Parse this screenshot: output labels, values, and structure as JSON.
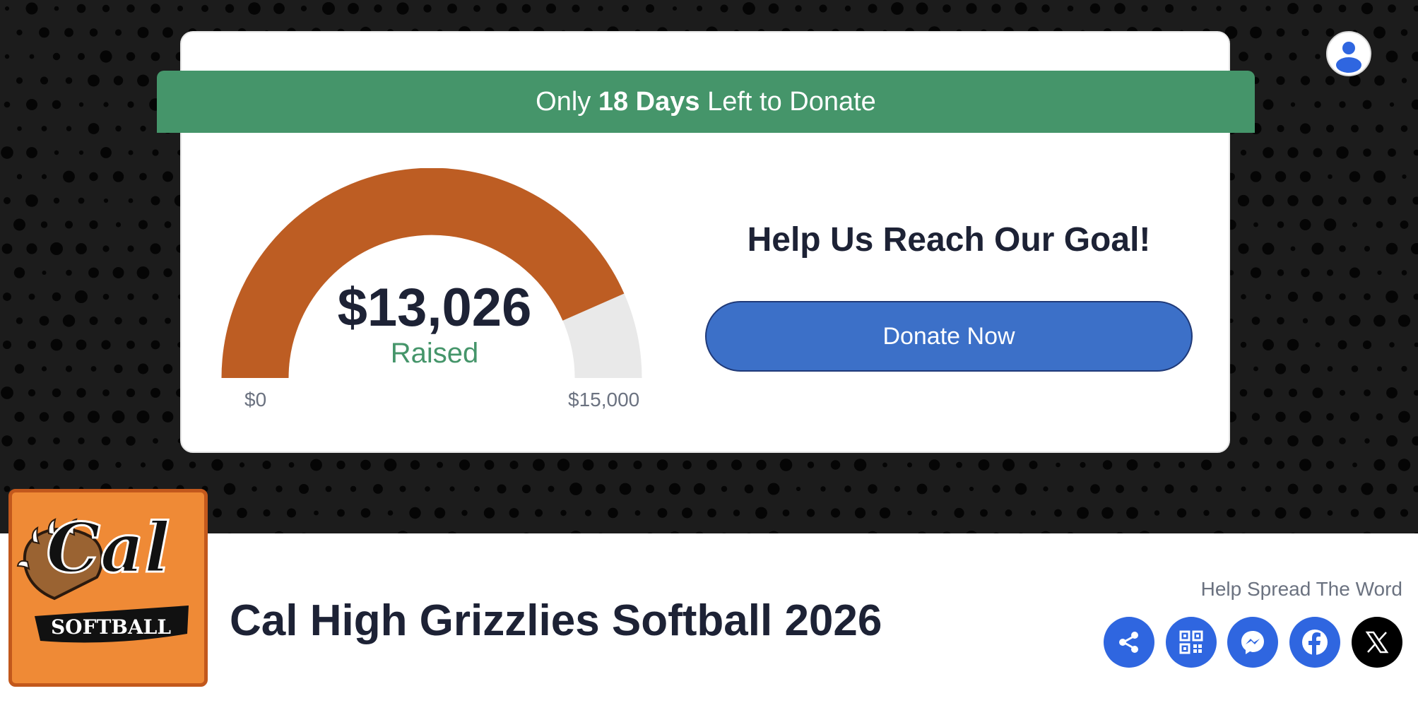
{
  "banner": {
    "prefix": "Only ",
    "days": "18 Days",
    "suffix": " Left to Donate"
  },
  "progress": {
    "amount_label": "$13,026",
    "status_label": "Raised",
    "raised_value": 13026,
    "goal_value": 15000,
    "min_label": "$0",
    "max_label": "$15,000"
  },
  "cta": {
    "heading": "Help Us Reach Our Goal!",
    "button_label": "Donate Now"
  },
  "campaign": {
    "title": "Cal High Grizzlies Softball 2026"
  },
  "logo": {
    "wordmark": "Cal",
    "subtext": "SOFTBALL"
  },
  "share": {
    "heading": "Help Spread The Word",
    "buttons": [
      "share-icon",
      "qr-code-icon",
      "messenger-icon",
      "facebook-icon",
      "x-icon"
    ]
  },
  "colors": {
    "banner": "#45956a",
    "gauge_fill": "#bd5d23",
    "gauge_track": "#e9e9e9",
    "donate_button": "#3c70c8",
    "share_button": "#2f66e0",
    "hero_background": "#1c1c1c",
    "logo_background": "#ef8a36"
  }
}
